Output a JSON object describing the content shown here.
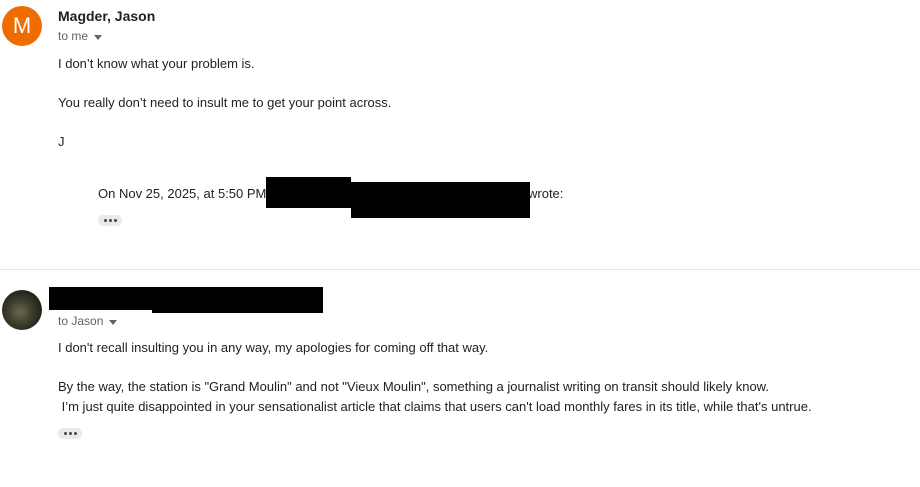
{
  "message1": {
    "avatar_letter": "M",
    "avatar_color": "#ef6c00",
    "sender": "Magder, Jason",
    "recipient": "to me",
    "body": [
      "I don’t know what your problem is.",
      "You really don’t need to insult me to get your point across.",
      "J"
    ],
    "quote_header": "On Nov 25, 2025, at 5:50 PM",
    "quote_suffix": "wrote:"
  },
  "message2": {
    "recipient": "to Jason",
    "body": [
      "I don't recall insulting you in any way, my apologies for coming off that way.",
      "By the way, the station is \"Grand Moulin\" and not \"Vieux Moulin\", something a journalist writing on transit should likely know.",
      " I’m just quite disappointed in your sensationalist article that claims that users can't load monthly fares in its title, while that's untrue."
    ]
  },
  "icons": {
    "recipient_details": "chevron-down-icon",
    "show_trimmed": "more-horiz-icon"
  }
}
